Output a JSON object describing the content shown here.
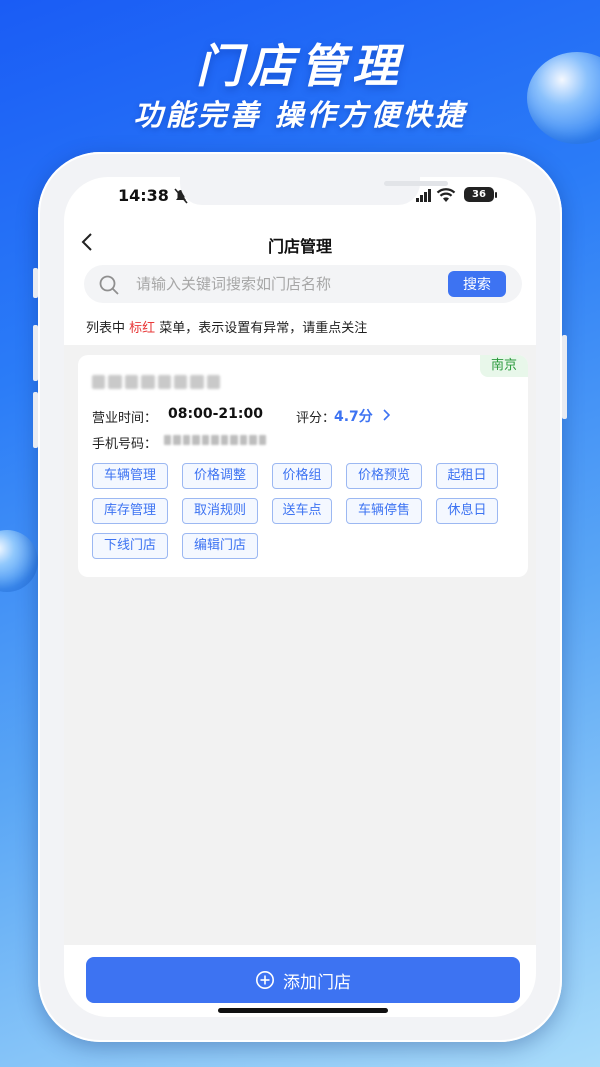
{
  "promo": {
    "title": "门店管理",
    "subtitle": "功能完善 操作方便快捷"
  },
  "status_bar": {
    "time": "14:38",
    "battery": "36"
  },
  "nav": {
    "title": "门店管理"
  },
  "search": {
    "placeholder": "请输入关键词搜索如门店名称",
    "button_label": "搜索"
  },
  "notice": {
    "prefix": "列表中 ",
    "highlight": "标红",
    "suffix": " 菜单，表示设置有异常，请重点关注",
    "highlight_color": "#e83a3a"
  },
  "store_card": {
    "city": "南京",
    "hours_label": "营业时间：",
    "hours_value": "08:00-21:00",
    "rating_label": "评分：",
    "rating_value": "4.7分",
    "phone_label": "手机号码："
  },
  "actions": [
    "车辆管理",
    "价格调整",
    "价格组",
    "价格预览",
    "起租日",
    "库存管理",
    "取消规则",
    "送车点",
    "车辆停售",
    "休息日",
    "下线门店",
    "编辑门店"
  ],
  "bottom": {
    "add_label": "添加门店"
  },
  "colors": {
    "primary": "#3d73f2",
    "city_tag": "#2a9a3c"
  }
}
